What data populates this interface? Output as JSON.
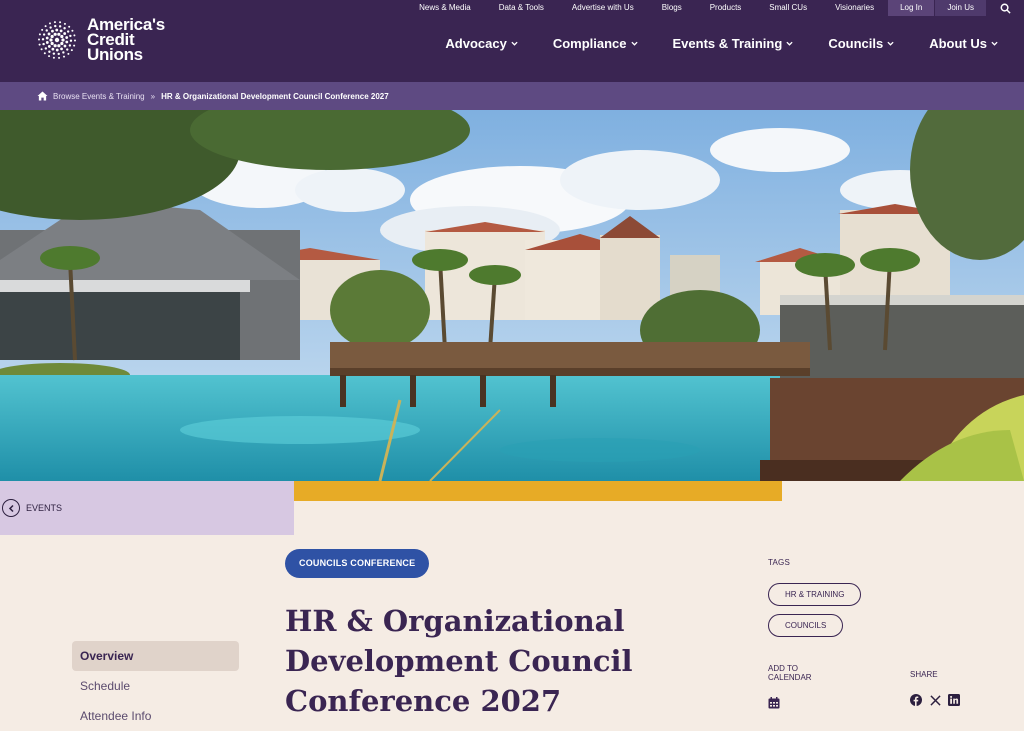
{
  "brand": {
    "logo_line1": "America's",
    "logo_line2": "Credit",
    "logo_line3": "Unions"
  },
  "utility_nav": {
    "items": [
      "News & Media",
      "Data & Tools",
      "Advertise with Us",
      "Blogs",
      "Products",
      "Small CUs",
      "Visionaries"
    ],
    "login": "Log In",
    "join": "Join Us"
  },
  "main_nav": {
    "items": [
      "Advocacy",
      "Compliance",
      "Events & Training",
      "Councils",
      "About Us"
    ]
  },
  "breadcrumb": {
    "parent": "Browse Events & Training",
    "separator": "»",
    "current": "HR & Organizational Development Council Conference 2027"
  },
  "events_link": "EVENTS",
  "badge": "COUNCILS CONFERENCE",
  "title": "HR & Organizational Development Council Conference 2027",
  "side_nav": [
    "Overview",
    "Schedule",
    "Attendee Info"
  ],
  "tags": {
    "heading": "TAGS",
    "items": [
      "HR & TRAINING",
      "COUNCILS"
    ]
  },
  "add_to_calendar": "ADD TO CALENDAR",
  "share": "SHARE",
  "colors": {
    "header": "#3a2552",
    "breadcrumb": "#5e4a82",
    "accent_gold": "#e7ab26",
    "badge_blue": "#2f52a5",
    "lavender": "#d7c8e2",
    "page_bg": "#f5ece4"
  },
  "icons": [
    "search-icon",
    "home-icon",
    "chevron-down-icon",
    "back-arrow-icon",
    "calendar-icon",
    "facebook-icon",
    "x-icon",
    "linkedin-icon"
  ]
}
